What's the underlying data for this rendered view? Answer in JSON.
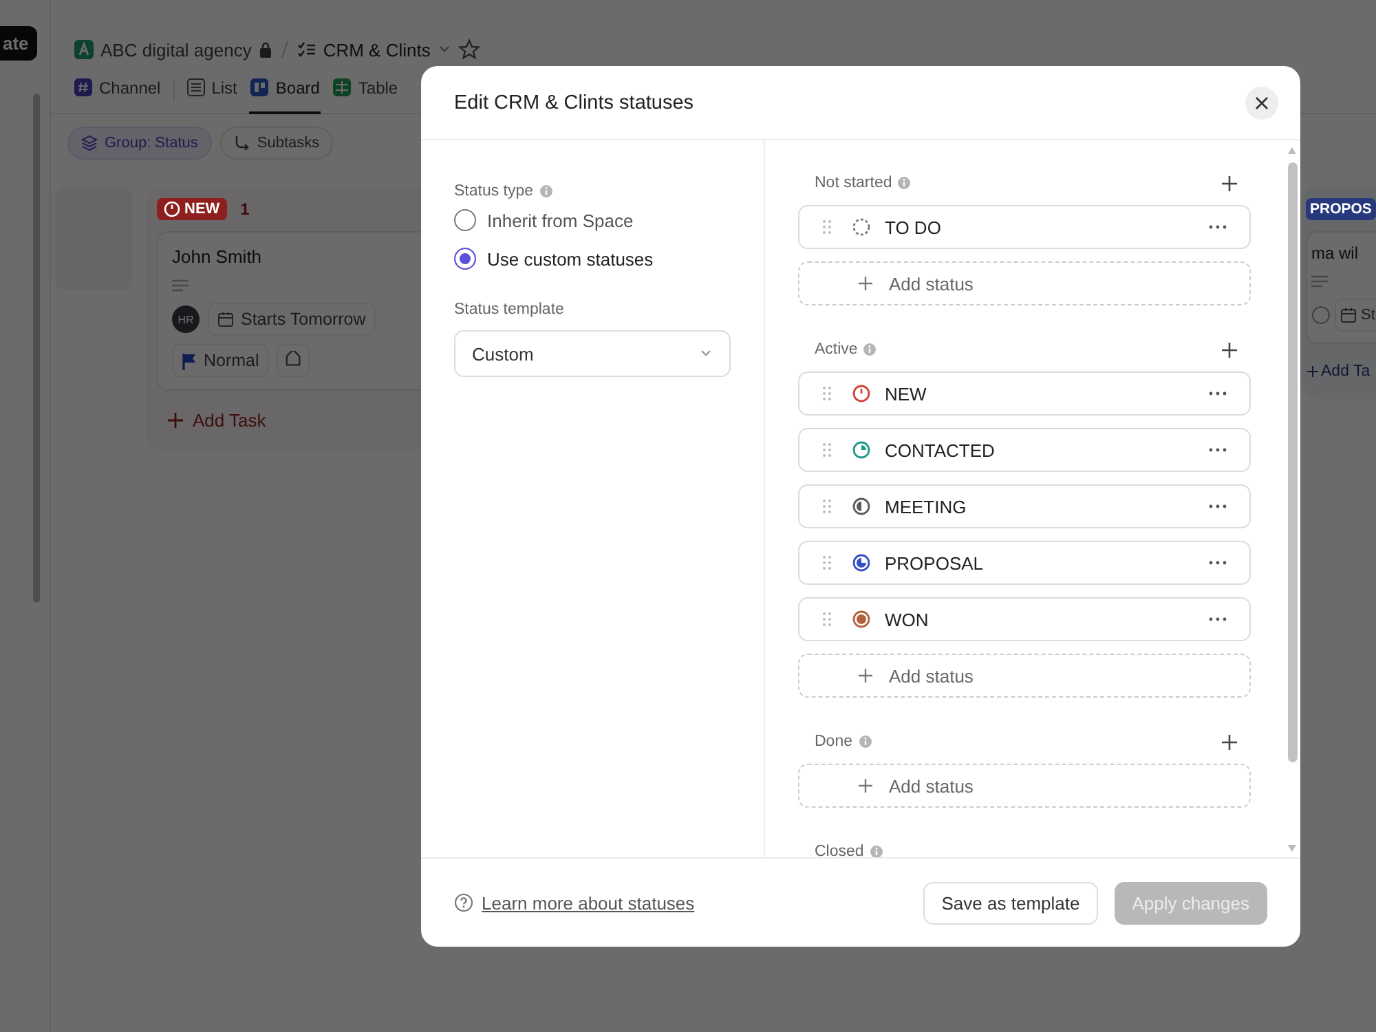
{
  "app": {
    "sidebar_button": "ate",
    "breadcrumb": {
      "workspace": "ABC digital agency",
      "list": "CRM & Clints"
    },
    "views": [
      {
        "label": "Channel",
        "kind": "channel",
        "selected": false
      },
      {
        "label": "List",
        "kind": "list",
        "selected": false
      },
      {
        "label": "Board",
        "kind": "board",
        "selected": true
      },
      {
        "label": "Table",
        "kind": "table",
        "selected": false
      }
    ],
    "filters": [
      {
        "label": "Group: Status",
        "kind": "group",
        "active": true
      },
      {
        "label": "Subtasks",
        "kind": "subtasks",
        "active": false
      }
    ],
    "board": {
      "columns": [
        {
          "status": "NEW",
          "count": "1",
          "color": "#8e1f1f",
          "cards": [
            {
              "title": "John Smith",
              "assignee": "HR",
              "date": "Starts Tomorrow",
              "priority": "Normal"
            }
          ],
          "add_label": "Add Task"
        },
        {
          "status": "PROPOS",
          "color": "#27397a",
          "cards": [
            {
              "title": "ma wil",
              "date": "St"
            }
          ],
          "add_label": "Add Ta"
        }
      ]
    }
  },
  "dialog": {
    "title": "Edit CRM & Clints statuses",
    "status_type": {
      "label": "Status type",
      "options": [
        {
          "label": "Inherit from Space",
          "selected": false
        },
        {
          "label": "Use custom statuses",
          "selected": true
        }
      ]
    },
    "status_template": {
      "label": "Status template",
      "value": "Custom"
    },
    "groups": [
      {
        "label": "Not started",
        "statuses": [
          {
            "name": "TO DO",
            "kind": "dashed",
            "color": "#7a7a7a"
          }
        ],
        "add_label": "Add status"
      },
      {
        "label": "Active",
        "statuses": [
          {
            "name": "NEW",
            "kind": "clock",
            "color": "#d4443a"
          },
          {
            "name": "CONTACTED",
            "kind": "quarter",
            "color": "#1d9a8c"
          },
          {
            "name": "MEETING",
            "kind": "half",
            "color": "#5c5c5c"
          },
          {
            "name": "PROPOSAL",
            "kind": "three-quarter",
            "color": "#3650c4"
          },
          {
            "name": "WON",
            "kind": "full",
            "color": "#b0633c"
          }
        ],
        "add_label": "Add status"
      },
      {
        "label": "Done",
        "add_label": "Add status"
      },
      {
        "label": "Closed"
      }
    ],
    "footer": {
      "link": "Learn more about statuses",
      "secondary_button": "Save as template",
      "primary_button": {
        "label": "Apply changes",
        "disabled": true
      }
    }
  }
}
